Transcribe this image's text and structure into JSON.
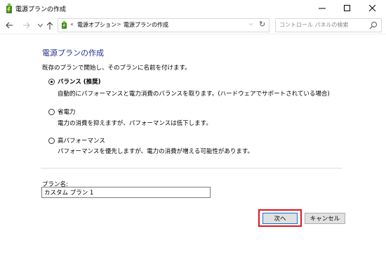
{
  "window": {
    "title": "電源プランの作成"
  },
  "nav": {
    "back_icon": "arrow-left",
    "forward_icon": "arrow-right",
    "history_icon": "chevron-down",
    "up_icon": "arrow-up",
    "address": {
      "overflow": "«",
      "crumbs": [
        "電源オプション",
        "電源プランの作成"
      ],
      "separator": ">",
      "dropdown": "⌵",
      "refresh": "↻"
    },
    "search": {
      "placeholder": "コントロール パネルの検索"
    }
  },
  "main": {
    "title": "電源プランの作成",
    "description": "既存のプランで開始し、そのプランに名前を付けます。",
    "options": [
      {
        "label": "バランス (推奨)",
        "description": "自動的にパフォーマンスと電力消費のバランスを取ります。(ハードウェアでサポートされている場合)",
        "selected": true
      },
      {
        "label": "省電力",
        "description": "電力の消費を抑えますが、パフォーマンスは低下します。",
        "selected": false
      },
      {
        "label": "高パフォーマンス",
        "description": "パフォーマンスを優先しますが、電力の消費が増える可能性があります。",
        "selected": false
      }
    ],
    "plan_name_label": "プラン名:",
    "plan_name_value": "カスタム プラン 1",
    "next_label": "次へ",
    "cancel_label": "キャンセル"
  },
  "colors": {
    "title_blue": "#1e3287",
    "highlight_red": "#e3121b",
    "button_face": "#e1e1e1",
    "focus_blue": "#0078d7"
  }
}
